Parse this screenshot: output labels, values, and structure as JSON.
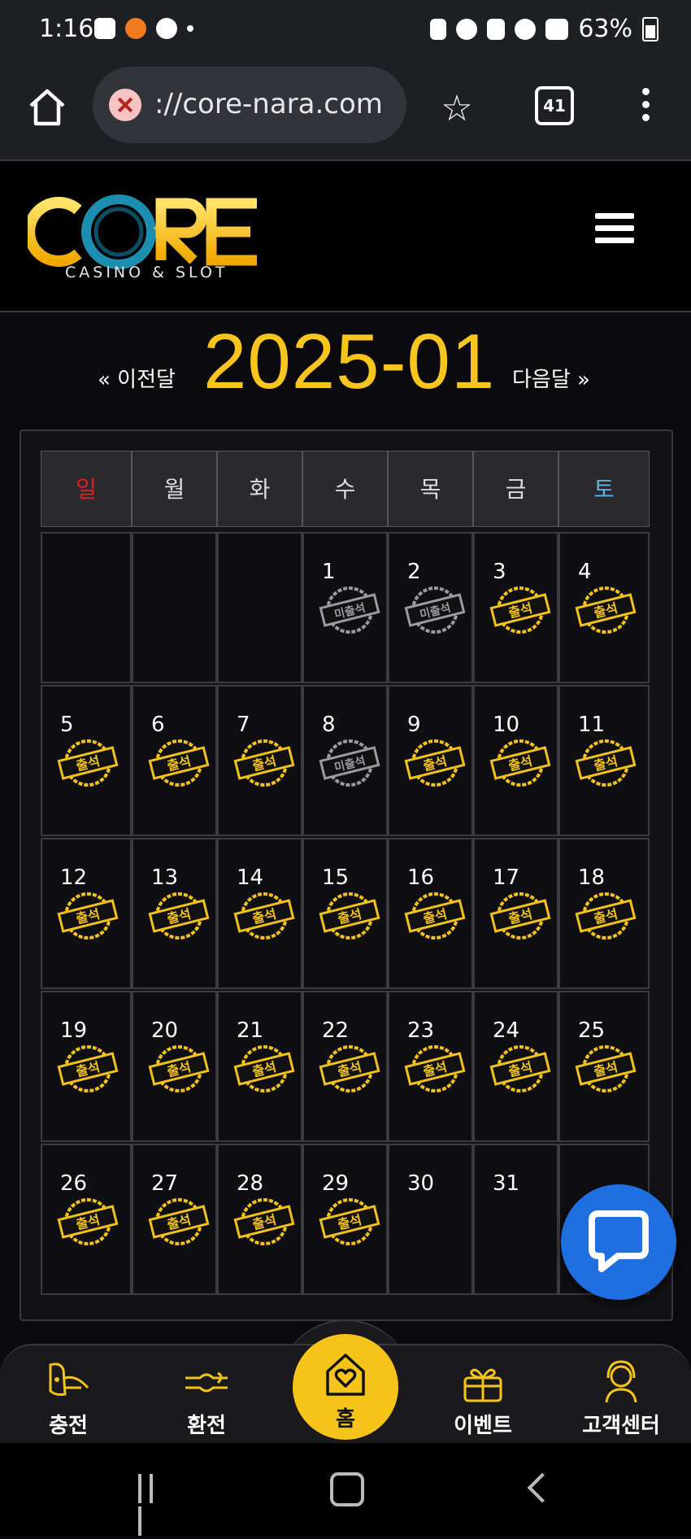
{
  "status_bar": {
    "time": "1:16",
    "battery": "63%"
  },
  "browser": {
    "url": "://core-nara.com",
    "tab_count": "41"
  },
  "site": {
    "logo_text": "CORE",
    "logo_subtitle": "CASINO & SLOT"
  },
  "calendar": {
    "prev_label": "« 이전달",
    "title": "2025-01",
    "next_label": "다음달 »",
    "weekdays": [
      "일",
      "월",
      "화",
      "수",
      "목",
      "금",
      "토"
    ],
    "weekday_colors": [
      "#e02020",
      "#dddddd",
      "#dddddd",
      "#dddddd",
      "#dddddd",
      "#dddddd",
      "#5ab4e6"
    ],
    "stamp_attended": "출석",
    "stamp_absent": "미출석",
    "days": [
      {
        "day": "",
        "stamp": ""
      },
      {
        "day": "",
        "stamp": ""
      },
      {
        "day": "",
        "stamp": ""
      },
      {
        "day": "1",
        "stamp": "absent"
      },
      {
        "day": "2",
        "stamp": "absent"
      },
      {
        "day": "3",
        "stamp": "attended"
      },
      {
        "day": "4",
        "stamp": "attended"
      },
      {
        "day": "5",
        "stamp": "attended"
      },
      {
        "day": "6",
        "stamp": "attended"
      },
      {
        "day": "7",
        "stamp": "attended"
      },
      {
        "day": "8",
        "stamp": "absent"
      },
      {
        "day": "9",
        "stamp": "attended"
      },
      {
        "day": "10",
        "stamp": "attended"
      },
      {
        "day": "11",
        "stamp": "attended"
      },
      {
        "day": "12",
        "stamp": "attended"
      },
      {
        "day": "13",
        "stamp": "attended"
      },
      {
        "day": "14",
        "stamp": "attended"
      },
      {
        "day": "15",
        "stamp": "attended"
      },
      {
        "day": "16",
        "stamp": "attended"
      },
      {
        "day": "17",
        "stamp": "attended"
      },
      {
        "day": "18",
        "stamp": "attended"
      },
      {
        "day": "19",
        "stamp": "attended"
      },
      {
        "day": "20",
        "stamp": "attended"
      },
      {
        "day": "21",
        "stamp": "attended"
      },
      {
        "day": "22",
        "stamp": "attended"
      },
      {
        "day": "23",
        "stamp": "attended"
      },
      {
        "day": "24",
        "stamp": "attended"
      },
      {
        "day": "25",
        "stamp": "attended"
      },
      {
        "day": "26",
        "stamp": "attended"
      },
      {
        "day": "27",
        "stamp": "attended"
      },
      {
        "day": "28",
        "stamp": "attended"
      },
      {
        "day": "29",
        "stamp": "attended"
      },
      {
        "day": "30",
        "stamp": ""
      },
      {
        "day": "31",
        "stamp": ""
      },
      {
        "day": "",
        "stamp": ""
      }
    ]
  },
  "bottom_nav": {
    "deposit": "충전",
    "withdraw": "환전",
    "home": "홈",
    "event": "이벤트",
    "support": "고객센터"
  },
  "colors": {
    "accent": "#f7c51e",
    "chat": "#1f6fe0"
  }
}
